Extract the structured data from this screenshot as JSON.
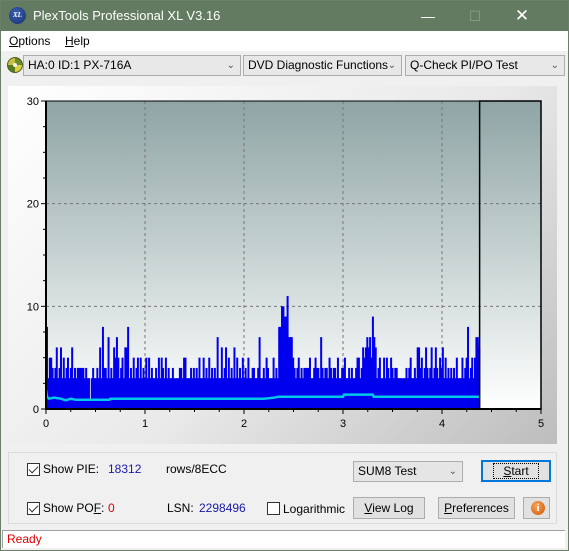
{
  "window": {
    "title": "PlexTools Professional XL V3.16",
    "app_icon": "xl-logo-icon",
    "controls": {
      "minimize": "—",
      "maximize": "☐",
      "close": "✕"
    }
  },
  "menu": {
    "items": [
      {
        "label": "Options",
        "accel": "O",
        "rest": "ptions"
      },
      {
        "label": "Help",
        "accel": "H",
        "rest": "elp"
      }
    ]
  },
  "toolbar": {
    "drive_icon": "disc-drive-icon",
    "drive": "HA:0 ID:1  PX-716A",
    "function": "DVD Diagnostic Functions",
    "test": "Q-Check PI/PO Test"
  },
  "colors": {
    "titlebar": "#637b60",
    "pie_bars": "#0000ee",
    "pif_line": "#00c8e8",
    "status_text": "#e00000",
    "value_blue": "#1a1aa8",
    "value_red": "#e00000"
  },
  "chart_data": {
    "type": "bar",
    "title": "",
    "xlabel": "",
    "ylabel": "",
    "xlim": [
      0,
      5
    ],
    "ylim": [
      0,
      30
    ],
    "x_ticks": [
      "0",
      "1",
      "2",
      "3",
      "4",
      "5"
    ],
    "y_ticks": [
      "0",
      "10",
      "20",
      "30"
    ],
    "grid": true,
    "end_marker_x": 4.38,
    "series": [
      {
        "name": "PIE",
        "x_start": 0,
        "x_end": 4.38,
        "values": [
          8,
          3,
          5,
          5,
          4,
          3,
          4,
          6,
          3,
          4,
          6,
          3,
          5,
          3,
          4,
          5,
          3,
          4,
          6,
          3,
          4,
          3,
          4,
          4,
          4,
          4,
          4,
          3,
          4,
          3,
          3,
          1,
          3,
          4,
          3,
          3,
          4,
          3,
          6,
          3,
          8,
          4,
          4,
          3,
          7,
          3,
          4,
          3,
          6,
          5,
          7,
          5,
          3,
          4,
          5,
          3,
          6,
          6,
          8,
          3,
          4,
          3,
          5,
          3,
          4,
          5,
          3,
          5,
          3,
          4,
          3,
          5,
          3,
          5,
          3,
          4,
          3,
          3,
          4,
          3,
          5,
          3,
          5,
          4,
          3,
          5,
          3,
          4,
          3,
          3,
          4,
          3,
          3,
          3,
          3,
          4,
          4,
          3,
          5,
          5,
          3,
          3,
          3,
          4,
          3,
          4,
          3,
          4,
          3,
          5,
          3,
          3,
          5,
          3,
          4,
          3,
          5,
          3,
          4,
          3,
          4,
          3,
          7,
          3,
          3,
          6,
          3,
          4,
          6,
          3,
          5,
          3,
          4,
          3,
          6,
          3,
          5,
          3,
          4,
          3,
          5,
          3,
          4,
          3,
          5,
          3,
          3,
          4,
          4,
          3,
          3,
          4,
          7,
          3,
          3,
          4,
          3,
          5,
          4,
          3,
          3,
          3,
          5,
          3,
          4,
          3,
          8,
          8,
          10,
          10,
          9,
          9,
          11,
          7,
          7,
          7,
          5,
          4,
          3,
          4,
          5,
          3,
          4,
          3,
          4,
          4,
          4,
          4,
          5,
          3,
          3,
          4,
          5,
          4,
          4,
          3,
          7,
          4,
          3,
          4,
          4,
          3,
          5,
          4,
          3,
          4,
          4,
          3,
          5,
          3,
          3,
          4,
          4,
          5,
          3,
          3,
          4,
          3,
          4,
          3,
          3,
          4,
          5,
          5,
          3,
          4,
          6,
          5,
          6,
          7,
          6,
          7,
          5,
          9,
          7,
          6,
          3,
          4,
          5,
          3,
          3,
          5,
          3,
          5,
          4,
          3,
          5,
          4,
          3,
          4,
          4,
          3,
          3,
          3,
          3,
          3,
          3,
          4,
          3,
          4,
          5,
          3,
          3,
          4,
          3,
          6,
          6,
          4,
          5,
          3,
          4,
          6,
          4,
          3,
          4,
          6,
          3,
          4,
          6,
          4,
          3,
          5,
          4,
          6,
          3,
          5,
          3,
          4,
          3,
          4,
          3,
          4,
          3,
          5,
          3,
          3,
          3,
          5,
          3,
          4,
          5,
          8,
          3,
          4,
          5,
          3,
          5,
          7,
          7,
          6
        ],
        "color": "#0000ee"
      },
      {
        "name": "PIF",
        "type": "line",
        "points": [
          [
            0,
            1.8
          ],
          [
            0.01,
            1.2
          ],
          [
            0.03,
            1.0
          ],
          [
            0.08,
            1.1
          ],
          [
            0.15,
            1.0
          ],
          [
            0.2,
            0.85
          ],
          [
            0.25,
            1.0
          ],
          [
            0.3,
            0.9
          ],
          [
            0.45,
            0.9
          ],
          [
            0.64,
            0.9
          ],
          [
            0.65,
            1.0
          ],
          [
            1.5,
            1.0
          ],
          [
            2.2,
            1.0
          ],
          [
            2.3,
            1.1
          ],
          [
            2.35,
            1.2
          ],
          [
            3.0,
            1.2
          ],
          [
            3.01,
            1.4
          ],
          [
            3.3,
            1.4
          ],
          [
            3.31,
            1.2
          ],
          [
            4.38,
            1.2
          ]
        ],
        "color": "#00c8e8"
      }
    ]
  },
  "bottom": {
    "show_pie_label": "Show PIE:",
    "show_pie_checked": true,
    "pie_value": "18312",
    "pie_unit": "rows/8ECC",
    "show_pof_label_pre": "Show PO",
    "show_pof_label_accel": "F",
    "show_pof_label_post": ":",
    "show_pof_checked": true,
    "pof_value": "0",
    "lsn_label": "LSN:",
    "lsn_value": "2298496",
    "logarithmic_label": "Logarithmic",
    "logarithmic_checked": false,
    "test_mode": "SUM8 Test",
    "start_accel": "S",
    "start_rest": "tart",
    "view_log_accel": "V",
    "view_log_rest": "iew Log",
    "preferences_accel": "P",
    "preferences_rest": "references",
    "info_icon": "info-icon"
  },
  "status": {
    "text": "Ready"
  }
}
